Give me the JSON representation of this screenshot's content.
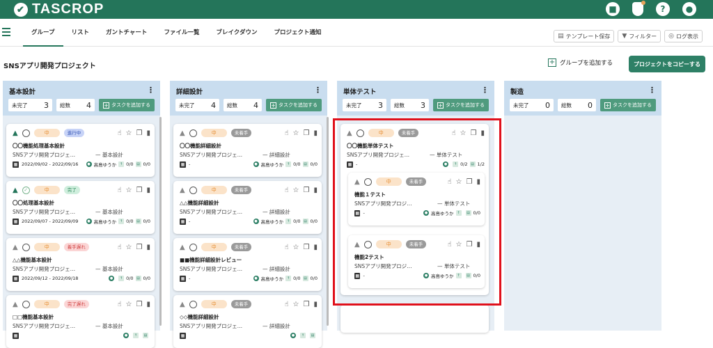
{
  "app": {
    "logo": "TASCROP",
    "logo_icon": "check-circle-icon"
  },
  "topbar": {
    "icons": [
      "trash-icon",
      "bell-icon",
      "help-icon",
      "user-icon"
    ],
    "help": "?"
  },
  "nav": {
    "tabs": [
      "グループ",
      "リスト",
      "ガントチャート",
      "ファイル一覧",
      "ブレイクダウン",
      "プロジェクト通知"
    ],
    "active": "グループ"
  },
  "tools": {
    "template": "テンプレート保存",
    "filter": "フィルター",
    "log": "ログ表示"
  },
  "project": {
    "title": "SNSアプリ開発プロジェクト",
    "add_group": "グループを追加する",
    "copy": "プロジェクトをコピーする"
  },
  "labels": {
    "incomplete": "未完了",
    "total": "総数",
    "add_task": "タスクを追加する"
  },
  "columns": [
    {
      "title": "基本設計",
      "incomplete": "3",
      "total": "4",
      "cards": [
        {
          "priority": "中",
          "status": "進行中",
          "status_type": "prog",
          "title": "〇〇機能処理基本設計",
          "project": "SNSアプリ開発プロジェ…",
          "group": "—  基本設計",
          "date": "2022/09/02 - 2022/09/16",
          "user": "高島ゆうか",
          "sub": "0/0",
          "file": "0/0",
          "done": false
        },
        {
          "priority": "中",
          "status": "完了",
          "status_type": "done",
          "title": "〇〇処理基本設計",
          "project": "SNSアプリ開発プロジェ…",
          "group": "—  基本設計",
          "date": "2022/09/07 - 2022/09/09",
          "user": "高島ゆうか",
          "sub": "0/0",
          "file": "0/0",
          "done": true
        },
        {
          "priority": "中",
          "status": "着手遅れ",
          "status_type": "late",
          "title": "△△機能基本設計",
          "project": "SNSアプリ開発プロジェ…",
          "group": "—  基本設計",
          "date": "2022/09/12 - 2022/09/18",
          "user": "",
          "sub": "0/0",
          "file": "0/0",
          "done": false
        },
        {
          "priority": "中",
          "status": "完了遅れ",
          "status_type": "late",
          "title": "□□機能基本設計",
          "project": "SNSアプリ開発プロジェ…",
          "group": "—  基本設計",
          "date": "",
          "user": "",
          "sub": "",
          "file": "",
          "done": false
        }
      ]
    },
    {
      "title": "詳細設計",
      "incomplete": "4",
      "total": "4",
      "cards": [
        {
          "priority": "中",
          "status": "未着手",
          "status_type": "none",
          "title": "〇〇機能詳細設計",
          "project": "SNSアプリ開発プロジェ…",
          "group": "—  詳細設計",
          "date": "-",
          "user": "高島ゆうか",
          "sub": "0/0",
          "file": "0/0",
          "done": false
        },
        {
          "priority": "中",
          "status": "未着手",
          "status_type": "none",
          "title": "△△機能詳細設計",
          "project": "SNSアプリ開発プロジェ…",
          "group": "—  詳細設計",
          "date": "-",
          "user": "高島ゆうか",
          "sub": "0/0",
          "file": "0/0",
          "done": false
        },
        {
          "priority": "中",
          "status": "未着手",
          "status_type": "none",
          "title": "■■機能詳細設計レビュー",
          "project": "SNSアプリ開発プロジェ…",
          "group": "—  詳細設計",
          "date": "-",
          "user": "高島ゆうか",
          "sub": "0/0",
          "file": "0/0",
          "done": false
        },
        {
          "priority": "中",
          "status": "未着手",
          "status_type": "none",
          "title": "◇◇機能詳細設計",
          "project": "SNSアプリ開発プロジェ…",
          "group": "—  詳細設計",
          "date": "",
          "user": "",
          "sub": "",
          "file": "",
          "done": false
        }
      ]
    },
    {
      "title": "単体テスト",
      "incomplete": "3",
      "total": "3",
      "cards": [
        {
          "priority": "中",
          "status": "未着手",
          "status_type": "none",
          "title": "〇〇機能単体テスト",
          "project": "SNSアプリ開発プロジェ…",
          "group": "—  単体テスト",
          "date": "-",
          "user": "",
          "sub": "0/2",
          "file": "1/2",
          "done": false
        },
        {
          "priority": "中",
          "status": "未着手",
          "status_type": "none",
          "title": "機能１テスト",
          "project": "SNSアプリ開発プロジ…",
          "group": "—  単体テスト",
          "date": "-",
          "user": "高島ゆうか",
          "sub": "",
          "file": "0/0",
          "done": false
        },
        {
          "priority": "中",
          "status": "未着手",
          "status_type": "none",
          "title": "機能2テスト",
          "project": "SNSアプリ開発プロジ…",
          "group": "—  単体テスト",
          "date": "-",
          "user": "高島ゆうか",
          "sub": "",
          "file": "0/0",
          "done": false
        }
      ]
    },
    {
      "title": "製造",
      "incomplete": "0",
      "total": "0",
      "cards": []
    }
  ]
}
